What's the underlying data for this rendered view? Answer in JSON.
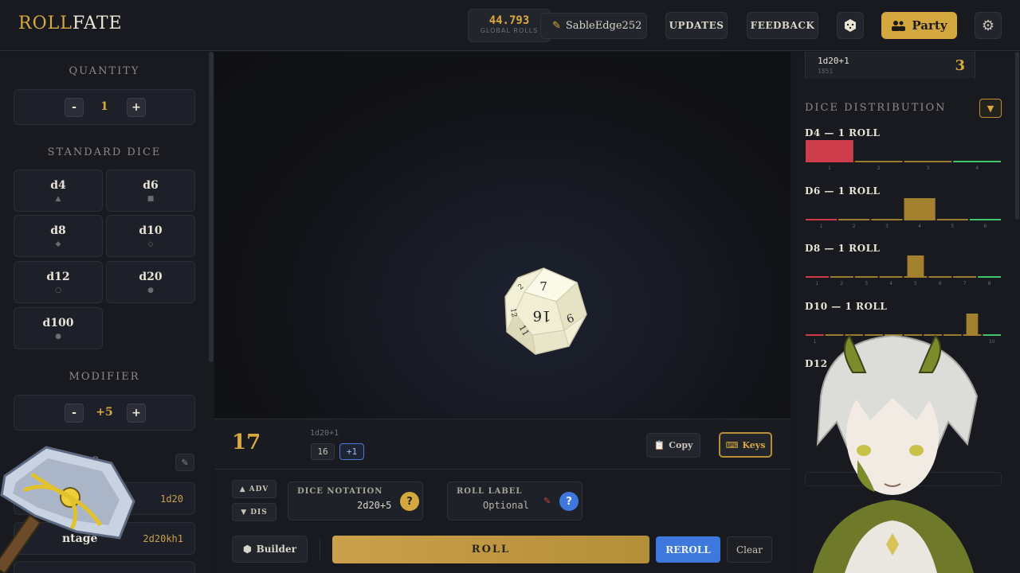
{
  "header": {
    "logo_part1": "ROLL",
    "logo_part2": "FATE",
    "global_rolls_value": "44.793",
    "global_rolls_label": "GLOBAL ROLLS",
    "username": "SableEdge252",
    "updates_label": "UPDATES",
    "feedback_label": "FEEDBACK",
    "party_label": "Party"
  },
  "left": {
    "quantity_title": "QUANTITY",
    "quantity_value": "1",
    "minus": "-",
    "plus": "+",
    "standard_dice_title": "STANDARD DICE",
    "dice": [
      {
        "label": "d4",
        "glyph": "▲"
      },
      {
        "label": "d6",
        "glyph": "■"
      },
      {
        "label": "d8",
        "glyph": "◆"
      },
      {
        "label": "d10",
        "glyph": "◇"
      },
      {
        "label": "d12",
        "glyph": "○"
      },
      {
        "label": "d20",
        "glyph": "●"
      },
      {
        "label": "d100",
        "glyph": "●"
      }
    ],
    "modifier_title": "MODIFIER",
    "modifier_value": "+5",
    "saved_rolls_visible_title": "LLS",
    "saved_rolls": [
      {
        "name": "A",
        "notation": "1d20"
      },
      {
        "name": "ntage",
        "notation": "2d20kh1"
      }
    ]
  },
  "center": {
    "die_faces": [
      "7",
      "16",
      "6",
      "11",
      "12",
      "2"
    ],
    "total": "17",
    "roll_notation": "1d20+1",
    "die_result": "16",
    "modifier_chip": "+1",
    "copy_label": "Copy",
    "keys_label": "Keys",
    "adv_label": "ADV",
    "dis_label": "DIS",
    "dice_notation_label": "DICE NOTATION",
    "dice_notation_value": "2d20+5",
    "roll_label_label": "ROLL LABEL",
    "roll_label_placeholder": "Optional",
    "help_glyph": "?",
    "builder_label": "Builder",
    "roll_label": "ROLL",
    "reroll_label": "REROLL",
    "clear_label": "Clear"
  },
  "right": {
    "history_notation": "1d20+1",
    "history_time": "1851",
    "history_value": "3",
    "distribution_title": "DICE DISTRIBUTION",
    "collapse_glyph": "▼",
    "distributions": [
      {
        "label": "D4 — 1 ROLL",
        "faces": [
          "1",
          "2",
          "3",
          "4"
        ],
        "counts": [
          1,
          0,
          0,
          0
        ]
      },
      {
        "label": "D6 — 1 ROLL",
        "faces": [
          "1",
          "2",
          "3",
          "4",
          "5",
          "6"
        ],
        "counts": [
          0,
          0,
          0,
          1,
          0,
          0
        ]
      },
      {
        "label": "D8 — 1 ROLL",
        "faces": [
          "1",
          "2",
          "3",
          "4",
          "5",
          "6",
          "7",
          "8"
        ],
        "counts": [
          0,
          0,
          0,
          0,
          1,
          0,
          0,
          0
        ]
      },
      {
        "label": "D10 — 1 ROLL",
        "faces": [
          "1",
          "10"
        ],
        "counts": [
          0,
          0,
          0,
          0,
          0,
          0,
          0,
          0,
          1,
          0
        ]
      },
      {
        "label": "D12",
        "faces": [
          "12"
        ],
        "counts": []
      }
    ]
  },
  "colors": {
    "accent_gold": "#d9a93e",
    "reroll_blue": "#3f78dc",
    "low_red": "#cf3d4c",
    "high_green": "#3ec46d"
  }
}
